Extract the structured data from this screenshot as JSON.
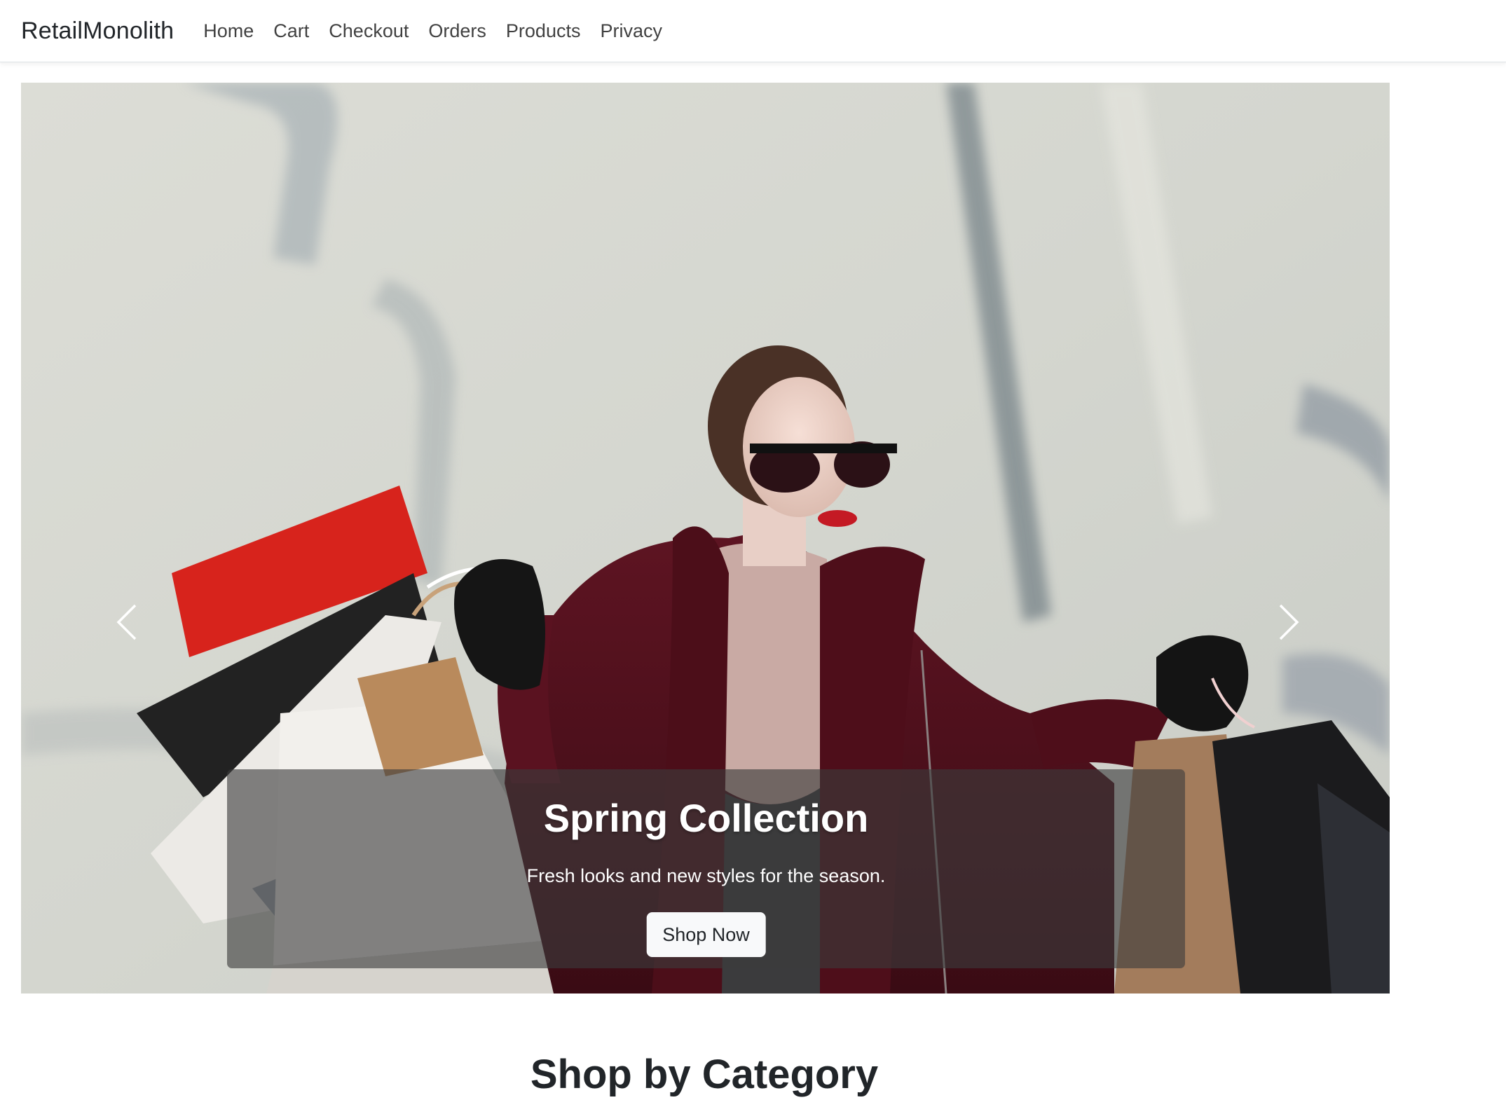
{
  "navbar": {
    "brand": "RetailMonolith",
    "links": [
      {
        "label": "Home"
      },
      {
        "label": "Cart"
      },
      {
        "label": "Checkout"
      },
      {
        "label": "Orders"
      },
      {
        "label": "Products"
      },
      {
        "label": "Privacy"
      }
    ]
  },
  "carousel": {
    "slide": {
      "title": "Spring Collection",
      "text": "Fresh looks and new styles for the season.",
      "button_label": "Shop Now"
    },
    "prev_icon": "chevron-left-icon",
    "next_icon": "chevron-right-icon"
  },
  "section": {
    "title": "Shop by Category"
  },
  "colors": {
    "caption_bg": "#3c3c3c",
    "button_bg": "#f8f9fa",
    "coat": "#5a1220",
    "text_dark": "#212529"
  }
}
